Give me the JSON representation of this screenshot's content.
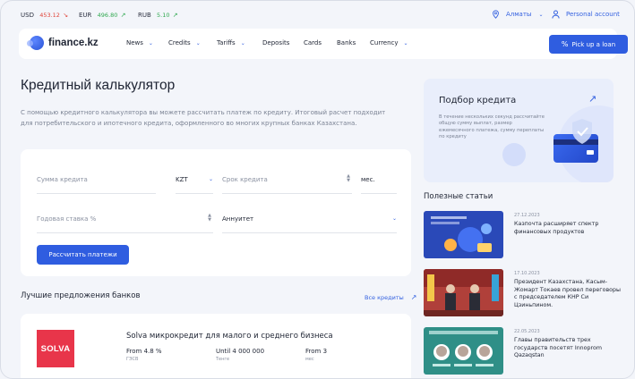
{
  "rates": [
    {
      "code": "USD",
      "value": "453.12",
      "dir": "down"
    },
    {
      "code": "EUR",
      "value": "496.80",
      "dir": "up"
    },
    {
      "code": "RUB",
      "value": "5.10",
      "dir": "up"
    }
  ],
  "header": {
    "city": "Алматы",
    "account": "Personal account"
  },
  "nav": {
    "logo": "finance.kz",
    "items": [
      "News",
      "Credits",
      "Tariffs",
      "Deposits",
      "Cards",
      "Banks",
      "Currency"
    ],
    "cta": "Pick up a loan"
  },
  "hero": {
    "title": "Кредитный калькулятор",
    "text": "С помощью кредитного калькулятора вы можете рассчитать платеж по кредиту. Итоговый расчет подходит для потребительского и ипотечного кредита, оформленного во многих крупных банках Казахстана."
  },
  "calc": {
    "amount_placeholder": "Сумма кредита",
    "currency": "KZT",
    "term_placeholder": "Срок кредита",
    "term_unit": "мес.",
    "rate_placeholder": "Годовая ставка %",
    "payment_type": "Аннуитет",
    "submit": "Рассчитать платежи"
  },
  "best": {
    "title": "Лучшие предложения банков",
    "all_link": "Все кредиты",
    "offer": {
      "logo": "SOLVA",
      "title": "Solva микрокредит для малого и среднего бизнеса",
      "stats": [
        {
          "value": "From 4.8 %",
          "sub": "ГЭСВ"
        },
        {
          "value": "Until 4 000 000",
          "sub": "Тенге"
        },
        {
          "value": "From 3",
          "sub": "мес"
        }
      ]
    }
  },
  "promo": {
    "title": "Подбор кредита",
    "text": "В течение нескольких секунд рассчитайте общую сумму выплат, размер ежемесячного платежа, сумму переплаты по кредиту"
  },
  "articles": {
    "title": "Полезные статьи",
    "items": [
      {
        "date": "27.12.2023",
        "title": "Казпочта расширяет спектр финансовых продуктов"
      },
      {
        "date": "17.10.2023",
        "title": "Президент Казахстана, Касым-Жомарт Токаев провел переговоры с председателем КНР Си Цзиньпином."
      },
      {
        "date": "22.05.2023",
        "title": "Главы правительств трех государств посетят Innoprom Qazaqstan"
      }
    ]
  }
}
